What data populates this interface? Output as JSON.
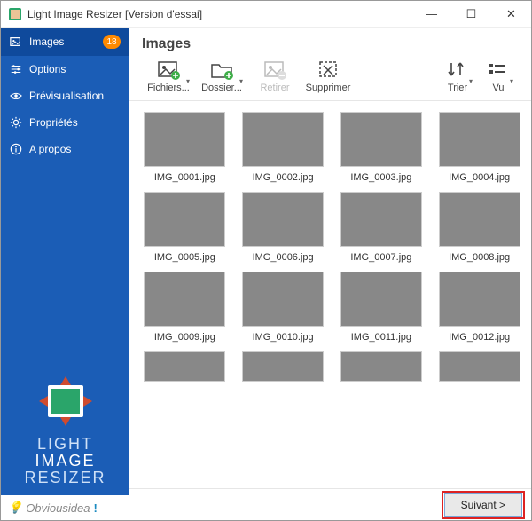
{
  "window": {
    "title": "Light Image Resizer  [Version d'essai]"
  },
  "sidebar": {
    "items": [
      {
        "label": "Images",
        "badge": "18"
      },
      {
        "label": "Options"
      },
      {
        "label": "Prévisualisation"
      },
      {
        "label": "Propriétés"
      },
      {
        "label": "A propos"
      }
    ],
    "brand_line1": "LIGHT",
    "brand_line2": "IMAGE",
    "brand_line3": "RESIZER",
    "footer": "Obviousidea"
  },
  "main": {
    "heading": "Images",
    "toolbar": {
      "files": "Fichiers...",
      "folder": "Dossier...",
      "remove": "Retirer",
      "delete": "Supprimer",
      "sort": "Trier",
      "view": "Vu"
    },
    "images": [
      {
        "name": "IMG_0001.jpg"
      },
      {
        "name": "IMG_0002.jpg"
      },
      {
        "name": "IMG_0003.jpg"
      },
      {
        "name": "IMG_0004.jpg"
      },
      {
        "name": "IMG_0005.jpg"
      },
      {
        "name": "IMG_0006.jpg"
      },
      {
        "name": "IMG_0007.jpg"
      },
      {
        "name": "IMG_0008.jpg"
      },
      {
        "name": "IMG_0009.jpg"
      },
      {
        "name": "IMG_0010.jpg"
      },
      {
        "name": "IMG_0011.jpg"
      },
      {
        "name": "IMG_0012.jpg"
      }
    ],
    "next": "Suivant >"
  }
}
